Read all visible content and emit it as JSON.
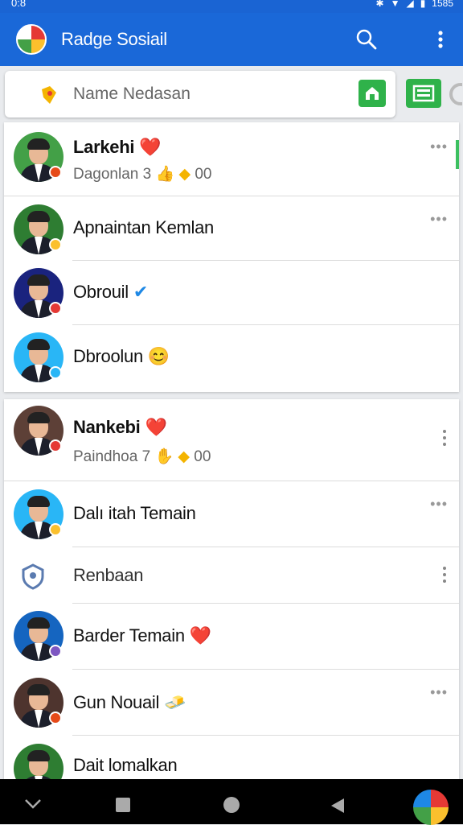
{
  "status_bar": {
    "time": "0:8",
    "battery": "1585"
  },
  "app_bar": {
    "title": "Radge Sosiail",
    "icons": [
      "logo-icon",
      "search-icon",
      "more-vert-icon"
    ]
  },
  "search": {
    "placeholder": "Name Nedasan",
    "value": ""
  },
  "colors": {
    "app_bar": "#1a68d8",
    "green": "#2fb24a",
    "heart": "#e53950"
  },
  "card1": {
    "rows": [
      {
        "name": "Larkehi",
        "emoji": "❤️",
        "sub": "Dagonlan 3",
        "sub_tail": "00",
        "bold": true,
        "badge_color": "#e64a19",
        "avatar_bg": "#43a047"
      },
      {
        "name": "Apnaintan Kemlan",
        "emoji": "",
        "bold": false,
        "badge_color": "#fbc02d",
        "avatar_bg": "#2e7d32"
      },
      {
        "name": "Obrouil",
        "emoji": "✔",
        "bold": false,
        "badge_color": "#e53935",
        "avatar_bg": "#1a237e"
      },
      {
        "name": "Dbroolun",
        "emoji": "😊",
        "bold": false,
        "badge_color": "#29b6f6",
        "avatar_bg": "#29b6f6"
      }
    ]
  },
  "card2": {
    "rows": [
      {
        "name": "Nankebi",
        "emoji": "❤️",
        "sub": "Paindhoa 7",
        "sub_tail": "00",
        "bold": true,
        "badge_color": "#e53935",
        "avatar_bg": "#5d4037"
      },
      {
        "name": "Dalı itah Temain",
        "emoji": "",
        "bold": false,
        "badge_color": "#fbc02d",
        "avatar_bg": "#29b6f6"
      },
      {
        "name": "Renbaan",
        "emoji": "",
        "bold": false,
        "icon": "shield-icon"
      },
      {
        "name": "Barder Temain",
        "emoji": "❤️",
        "bold": false,
        "badge_color": "#7e57c2",
        "avatar_bg": "#1565c0"
      },
      {
        "name": "Gun Nouail",
        "emoji": "🧈",
        "bold": false,
        "badge_color": "#e64a19",
        "avatar_bg": "#4e342e"
      },
      {
        "name": "Dait lomalkan",
        "emoji": "",
        "bold": false,
        "badge_color": "#43a047",
        "avatar_bg": "#2e7d32"
      }
    ]
  },
  "more_label": "•••"
}
